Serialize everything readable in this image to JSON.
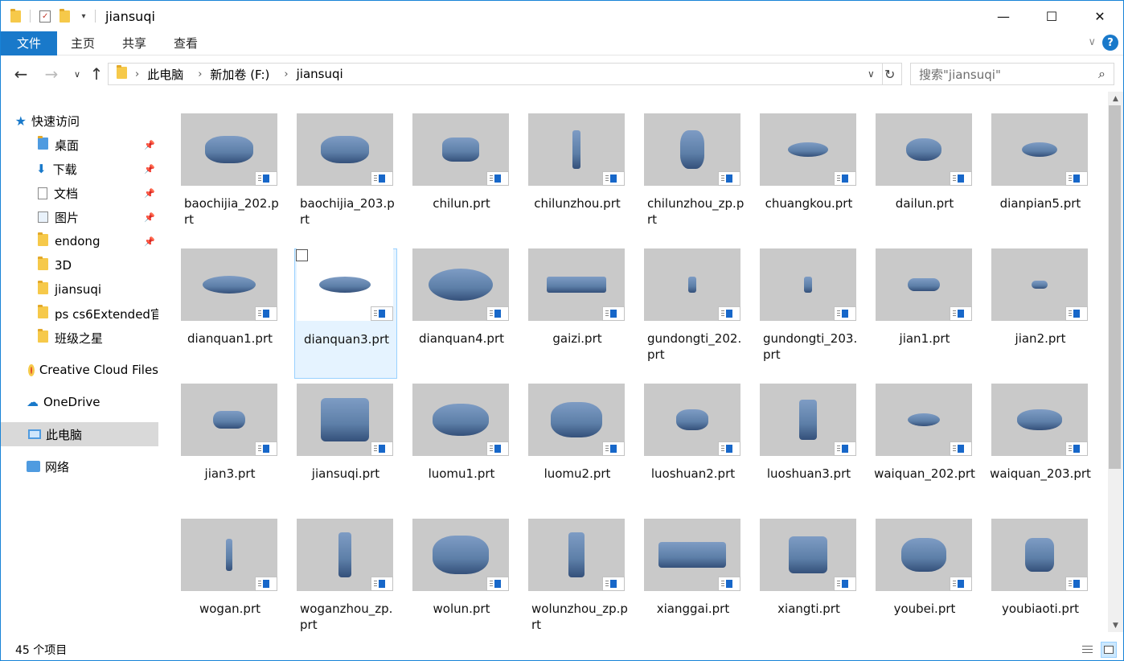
{
  "window": {
    "title": "jiansuqi",
    "minimize_glyph": "—",
    "maximize_glyph": "☐",
    "close_glyph": "✕"
  },
  "ribbon": {
    "tabs": [
      "文件",
      "主页",
      "共享",
      "查看"
    ],
    "help_glyph": "?",
    "expand_glyph": "∨"
  },
  "address": {
    "crumbs": [
      "此电脑",
      "新加卷 (F:)",
      "jiansuqi"
    ],
    "search_placeholder": "搜索\"jiansuqi\""
  },
  "nav": {
    "quick_access": "快速访问",
    "pinned": [
      "桌面",
      "下载",
      "文档",
      "图片",
      "endong"
    ],
    "folders": [
      "3D",
      "jiansuqi",
      "ps cs6Extended官",
      "班级之星"
    ],
    "creative_cloud": "Creative Cloud Files",
    "onedrive": "OneDrive",
    "this_pc": "此电脑",
    "network": "网络"
  },
  "files": [
    "baochijia_202.prt",
    "baochijia_203.prt",
    "chilun.prt",
    "chilunzhou.prt",
    "chilunzhou_zp.prt",
    "chuangkou.prt",
    "dailun.prt",
    "dianpian5.prt",
    "dianquan1.prt",
    "dianquan3.prt",
    "dianquan4.prt",
    "gaizi.prt",
    "gundongti_202.prt",
    "gundongti_203.prt",
    "jian1.prt",
    "jian2.prt",
    "jian3.prt",
    "jiansuqi.prt",
    "luomu1.prt",
    "luomu2.prt",
    "luoshuan2.prt",
    "luoshuan3.prt",
    "waiquan_202.prt",
    "waiquan_203.prt",
    "wogan.prt",
    "woganzhou_zp.prt",
    "wolun.prt",
    "wolunzhou_zp.prt",
    "xianggai.prt",
    "xiangti.prt",
    "youbei.prt",
    "youbiaoti.prt"
  ],
  "selected_file": "dianquan3.prt",
  "status": {
    "count": "45 个项目"
  },
  "colors": {
    "accent": "#1979ca",
    "part_blue": "#5d7fa8",
    "thumb_bg": "#c9c9c9",
    "selection": "#e5f3ff"
  }
}
